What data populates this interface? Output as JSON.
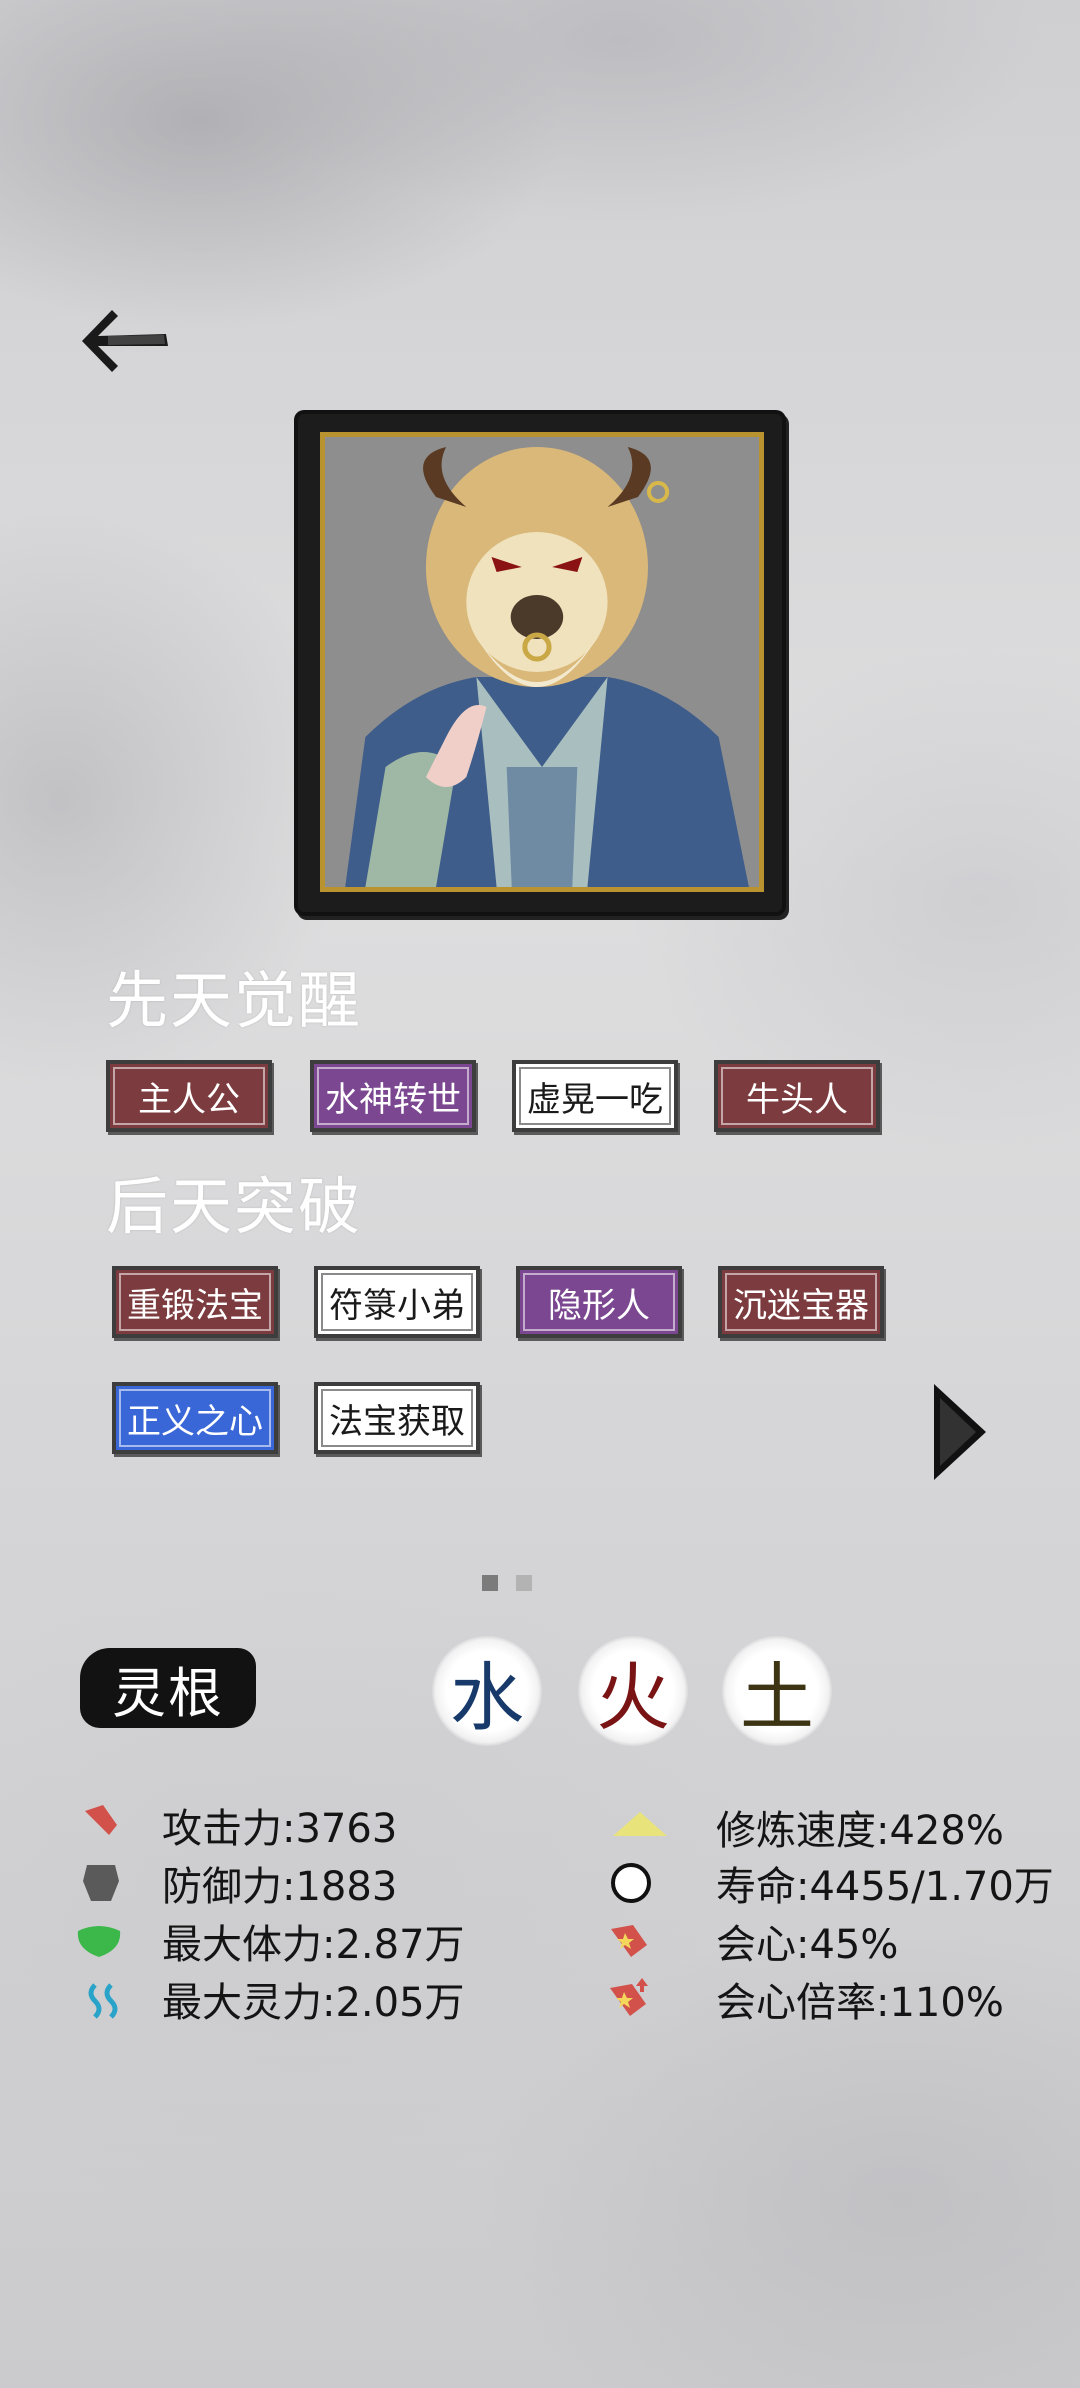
{
  "sections": {
    "innate_title": "先天觉醒",
    "acquired_title": "后天突破"
  },
  "innate_tags": [
    {
      "label": "主人公",
      "style": "red"
    },
    {
      "label": "水神转世",
      "style": "purple"
    },
    {
      "label": "虚晃一吃",
      "style": "white"
    },
    {
      "label": "牛头人",
      "style": "red"
    }
  ],
  "acquired_tags": [
    {
      "label": "重锻法宝",
      "style": "red"
    },
    {
      "label": "符箓小弟",
      "style": "white"
    },
    {
      "label": "隐形人",
      "style": "purple"
    },
    {
      "label": "沉迷宝器",
      "style": "red"
    },
    {
      "label": "正义之心",
      "style": "blue"
    },
    {
      "label": "法宝获取",
      "style": "white"
    }
  ],
  "pagination": {
    "current": 1,
    "total": 2
  },
  "linggen": {
    "label": "灵根",
    "elements": [
      {
        "char": "水",
        "color": "#173a6b"
      },
      {
        "char": "火",
        "color": "#7a1414"
      },
      {
        "char": "土",
        "color": "#3d3413"
      }
    ]
  },
  "stats_left": [
    {
      "icon": "sword-icon",
      "text": "攻击力:3763",
      "color": "#d2514b"
    },
    {
      "icon": "shield-icon",
      "text": "防御力:1883",
      "color": "#5a5a5a"
    },
    {
      "icon": "hp-icon",
      "text": "最大体力:2.87万",
      "color": "#3cb84a"
    },
    {
      "icon": "spirit-icon",
      "text": "最大灵力:2.05万",
      "color": "#2aa3c9"
    }
  ],
  "stats_right": [
    {
      "icon": "cultivation-speed-icon",
      "text": "修炼速度:428%",
      "color": "#e8e37a"
    },
    {
      "icon": "lifespan-icon",
      "text": "寿命:4455/1.70万",
      "color": "#111111"
    },
    {
      "icon": "crit-icon",
      "text": "会心:45%",
      "color": "#d2514b"
    },
    {
      "icon": "crit-multiplier-icon",
      "text": "会心倍率:110%",
      "color": "#d2514b"
    }
  ]
}
